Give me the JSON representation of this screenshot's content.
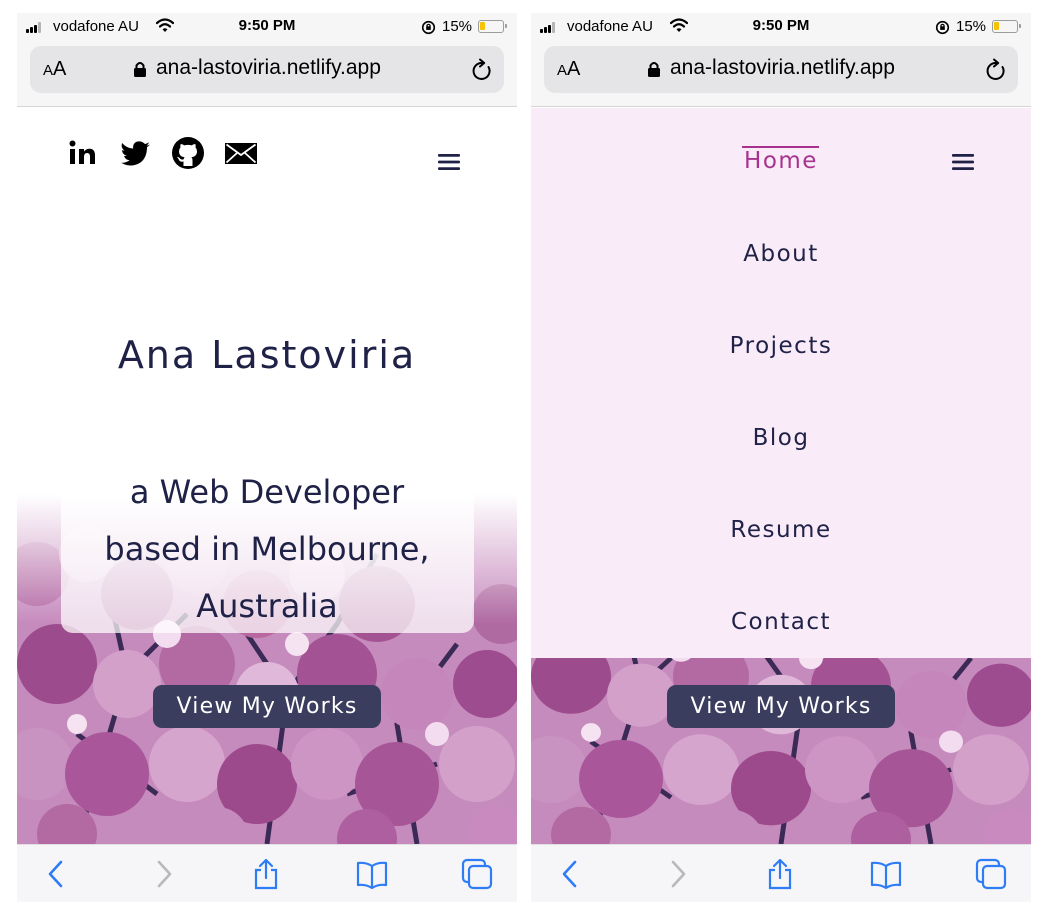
{
  "status_bar": {
    "carrier": "vodafone AU",
    "time": "9:50 PM",
    "battery_percent": "15%",
    "icons": [
      "signal-icon",
      "wifi-icon",
      "orientation-lock-icon",
      "battery-icon"
    ]
  },
  "browser": {
    "text_size_label_small": "A",
    "text_size_label_large": "A",
    "url": "ana-lastoviria.netlify.app",
    "toolbar_icons": [
      "back-icon",
      "forward-icon",
      "share-icon",
      "bookmarks-icon",
      "tabs-icon"
    ]
  },
  "home": {
    "social_icons": [
      "linkedin-icon",
      "twitter-icon",
      "github-icon",
      "email-icon"
    ],
    "name": "Ana Lastoviria",
    "tagline": [
      "a Web Developer",
      "based in Melbourne,",
      "Australia"
    ],
    "cta_label": "View My Works"
  },
  "menu": {
    "items": [
      "Home",
      "About",
      "Projects",
      "Blog",
      "Resume",
      "Contact"
    ],
    "active": "Home"
  },
  "colors": {
    "heading": "#1f2147",
    "button": "#3b3d5e",
    "menu_background": "#f9ebf7",
    "menu_active": "#a8338f",
    "ios_blue": "#2f7df6"
  }
}
